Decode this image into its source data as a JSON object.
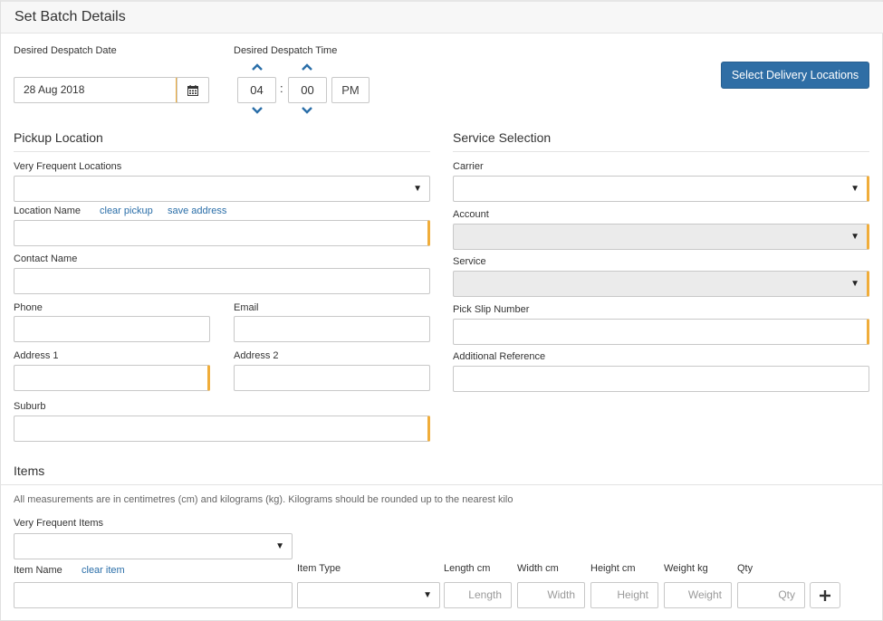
{
  "header": {
    "title": "Set Batch Details"
  },
  "despatch": {
    "date_label": "Desired Despatch Date",
    "date_value": "28 Aug 2018",
    "time_label": "Desired Despatch Time",
    "hour": "04",
    "separator": ":",
    "minute": "00",
    "ampm": "PM"
  },
  "actions": {
    "select_delivery_locations": "Select Delivery Locations"
  },
  "pickup": {
    "section_title": "Pickup Location",
    "frequent_label": "Very Frequent Locations",
    "location_name_label": "Location Name",
    "clear_pickup": "clear pickup",
    "save_address": "save address",
    "contact_name_label": "Contact Name",
    "phone_label": "Phone",
    "email_label": "Email",
    "address1_label": "Address 1",
    "address2_label": "Address 2",
    "suburb_label": "Suburb"
  },
  "service": {
    "section_title": "Service Selection",
    "carrier_label": "Carrier",
    "account_label": "Account",
    "service_label": "Service",
    "pick_slip_label": "Pick Slip Number",
    "additional_ref_label": "Additional Reference"
  },
  "items": {
    "section_title": "Items",
    "note": "All measurements are in centimetres (cm) and kilograms (kg). Kilograms should be rounded up to the nearest kilo",
    "frequent_label": "Very Frequent Items",
    "item_name_label": "Item Name",
    "clear_item": "clear item",
    "item_type_label": "Item Type",
    "length_label": "Length cm",
    "width_label": "Width cm",
    "height_label": "Height cm",
    "weight_label": "Weight kg",
    "qty_label": "Qty",
    "length_ph": "Length",
    "width_ph": "Width",
    "height_ph": "Height",
    "weight_ph": "Weight",
    "qty_ph": "Qty"
  },
  "icons": {
    "calendar": "calendar-icon",
    "chevron_up": "chevron-up-icon",
    "chevron_down": "chevron-down-icon",
    "caret_down": "caret-down-icon",
    "plus": "plus-icon"
  },
  "colors": {
    "primary": "#2f6ea5",
    "required_marker": "#f0ad3a",
    "link": "#2a6ea8",
    "chevron": "#2a6ea8"
  }
}
